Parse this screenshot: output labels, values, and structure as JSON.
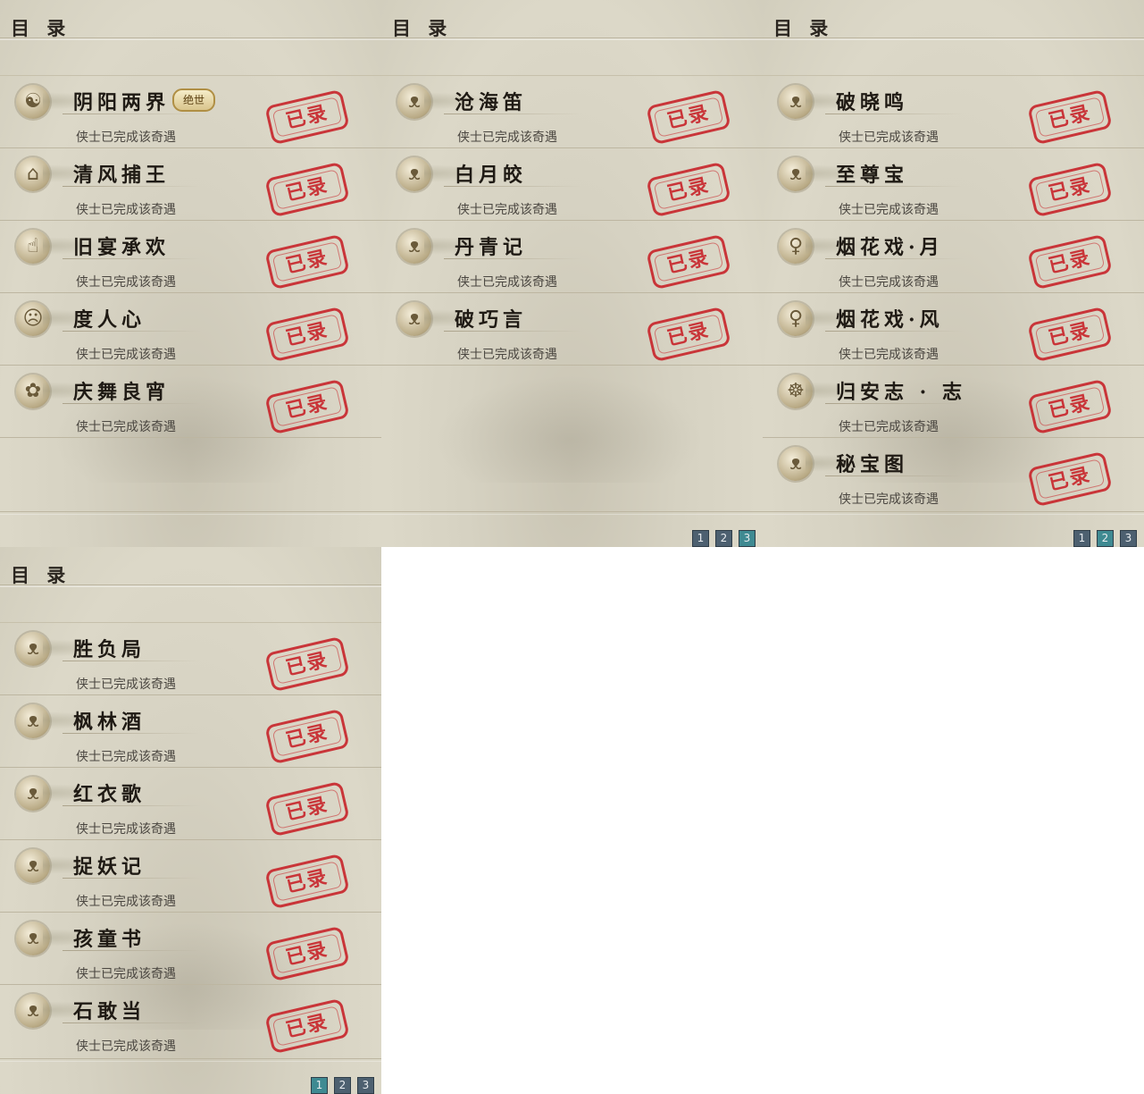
{
  "panels": [
    {
      "title": "目 录",
      "items": [
        {
          "name": "阴阳两界",
          "badge": "绝世",
          "status": "侠士已完成该奇遇",
          "stamp": "已录",
          "icon": "yin-yang-icon"
        },
        {
          "name": "清风捕王",
          "status": "侠士已完成该奇遇",
          "stamp": "已录",
          "icon": "hat-icon"
        },
        {
          "name": "旧宴承欢",
          "status": "侠士已完成该奇遇",
          "stamp": "已录",
          "icon": "thumbs-up-icon"
        },
        {
          "name": "度人心",
          "status": "侠士已完成该奇遇",
          "stamp": "已录",
          "icon": "mask-icon"
        },
        {
          "name": "庆舞良宵",
          "status": "侠士已完成该奇遇",
          "stamp": "已录",
          "icon": "lion-dance-icon"
        }
      ],
      "pager": []
    },
    {
      "title": "目 录",
      "items": [
        {
          "name": "沧海笛",
          "status": "侠士已完成该奇遇",
          "stamp": "已录",
          "icon": "cat-icon"
        },
        {
          "name": "白月皎",
          "status": "侠士已完成该奇遇",
          "stamp": "已录",
          "icon": "cat-icon"
        },
        {
          "name": "丹青记",
          "status": "侠士已完成该奇遇",
          "stamp": "已录",
          "icon": "cat-icon"
        },
        {
          "name": "破巧言",
          "status": "侠士已完成该奇遇",
          "stamp": "已录",
          "icon": "cat-icon"
        }
      ],
      "pager": [
        "1",
        "2",
        "3"
      ],
      "active_page": "3"
    },
    {
      "title": "目 录",
      "items": [
        {
          "name": "破晓鸣",
          "status": "侠士已完成该奇遇",
          "stamp": "已录",
          "icon": "cat-icon"
        },
        {
          "name": "至尊宝",
          "status": "侠士已完成该奇遇",
          "stamp": "已录",
          "icon": "cat-icon"
        },
        {
          "name": "烟花戏·月",
          "status": "侠士已完成该奇遇",
          "stamp": "已录",
          "icon": "lady-icon"
        },
        {
          "name": "烟花戏·风",
          "status": "侠士已完成该奇遇",
          "stamp": "已录",
          "icon": "lady-icon"
        },
        {
          "name": "归安志 · 志",
          "status": "侠士已完成该奇遇",
          "stamp": "已录",
          "icon": "buddha-icon"
        },
        {
          "name": "秘宝图",
          "status": "侠士已完成该奇遇",
          "stamp": "已录",
          "icon": "cat-icon"
        }
      ],
      "pager": [
        "1",
        "2",
        "3"
      ],
      "active_page": "2"
    },
    {
      "title": "目 录",
      "items": [
        {
          "name": "胜负局",
          "status": "侠士已完成该奇遇",
          "stamp": "已录",
          "icon": "cat-icon"
        },
        {
          "name": "枫林酒",
          "status": "侠士已完成该奇遇",
          "stamp": "已录",
          "icon": "cat-icon"
        },
        {
          "name": "红衣歌",
          "status": "侠士已完成该奇遇",
          "stamp": "已录",
          "icon": "cat-icon"
        },
        {
          "name": "捉妖记",
          "status": "侠士已完成该奇遇",
          "stamp": "已录",
          "icon": "cat-icon"
        },
        {
          "name": "孩童书",
          "status": "侠士已完成该奇遇",
          "stamp": "已录",
          "icon": "cat-icon"
        },
        {
          "name": "石敢当",
          "status": "侠士已完成该奇遇",
          "stamp": "已录",
          "icon": "cat-icon"
        }
      ],
      "pager": [
        "1",
        "2",
        "3"
      ],
      "active_page": "1"
    }
  ],
  "colors": {
    "stamp": "#c8242a",
    "page_active": "#3f8a92",
    "page_normal": "#4d6070"
  }
}
